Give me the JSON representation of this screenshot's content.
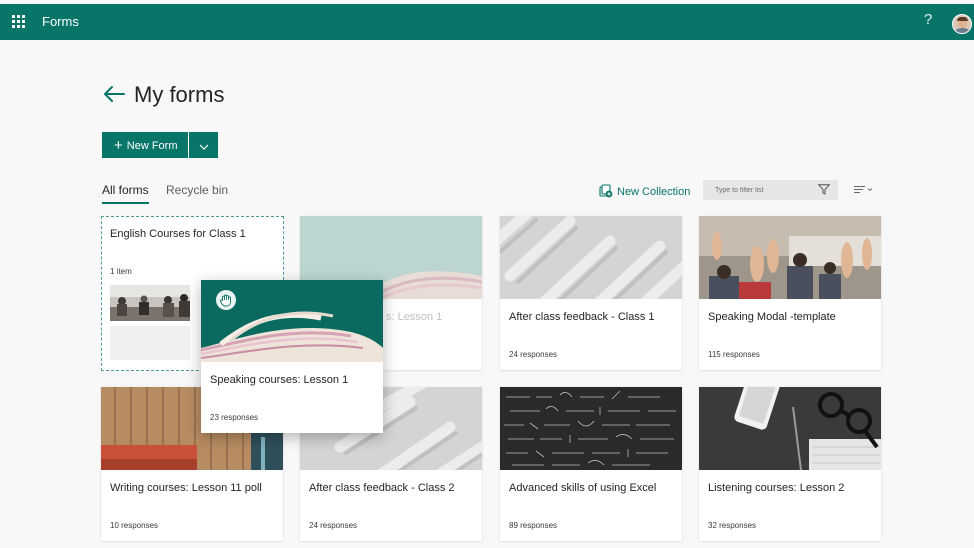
{
  "app": {
    "name": "Forms"
  },
  "header": {
    "help_glyph": "?"
  },
  "page": {
    "title": "My forms"
  },
  "toolbar": {
    "new_form_label": "New Form"
  },
  "tabs": [
    {
      "label": "All forms",
      "selected": true
    },
    {
      "label": "Recycle bin",
      "selected": false
    }
  ],
  "actions": {
    "new_collection_label": "New Collection",
    "filter_placeholder": "Type to filter list"
  },
  "collection": {
    "title": "English Courses for Class 1",
    "count": "1 item"
  },
  "dragging_card": {
    "title": "Speaking courses: Lesson 1",
    "responses": "23 responses"
  },
  "ghost_card": {
    "title_fragment": "s: Lesson 1"
  },
  "cards": [
    {
      "title": "After class feedback - Class 1",
      "responses": "24 responses"
    },
    {
      "title": "Speaking Modal -template",
      "responses": "115 responses"
    },
    {
      "title": "Writing courses: Lesson 11 poll",
      "responses": "10 responses"
    },
    {
      "title": "After class feedback - Class 2",
      "responses": "24 responses"
    },
    {
      "title": "Advanced skills of using Excel",
      "responses": "89 responses"
    },
    {
      "title": "Listening courses: Lesson 2",
      "responses": "32 responses"
    }
  ],
  "colors": {
    "brand": "#077568",
    "background": "#f8f8f8",
    "card": "#ffffff"
  },
  "icons": [
    "waffle-icon",
    "help-icon",
    "back-arrow-icon",
    "plus-icon",
    "chevron-down-icon",
    "new-collection-icon",
    "filter-icon",
    "sort-icon",
    "grab-hand-icon"
  ]
}
